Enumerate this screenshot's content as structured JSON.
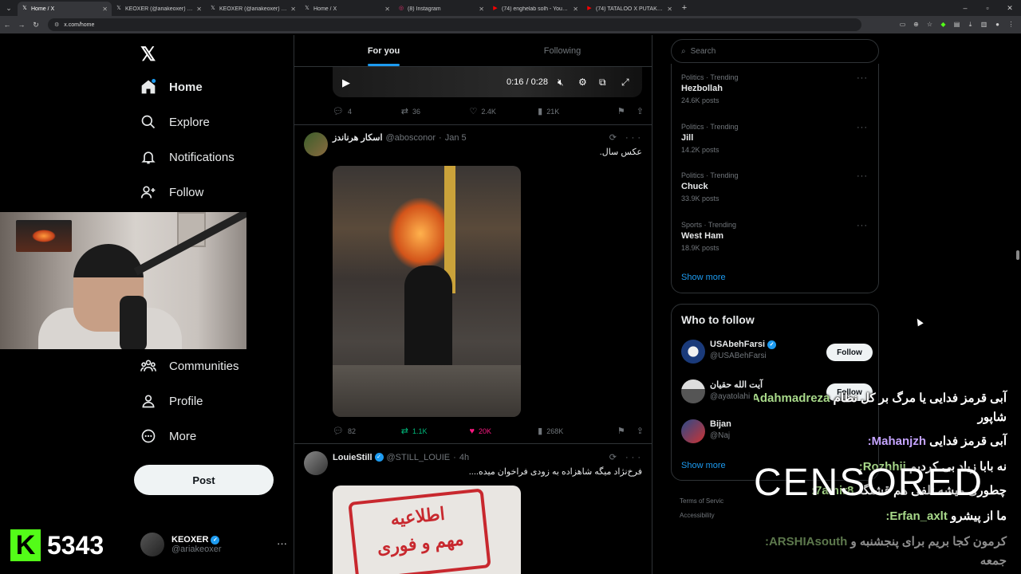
{
  "browser": {
    "tabs": [
      {
        "icon": "x-icon",
        "title": "Home / X",
        "active": true
      },
      {
        "icon": "x-icon",
        "title": "KEOXER (@ariakeoxer) / X"
      },
      {
        "icon": "x-icon",
        "title": "KEOXER (@ariakeoxer) / X"
      },
      {
        "icon": "x-icon",
        "title": "Home / X"
      },
      {
        "icon": "instagram-icon",
        "title": "(8) Instagram"
      },
      {
        "icon": "youtube-icon",
        "title": "(74) enghelab solh - YouTube"
      },
      {
        "icon": "youtube-icon",
        "title": "(74) TATALOO X PUTAK X PISHRO"
      }
    ],
    "url": "x.com/home"
  },
  "nav": {
    "items": [
      {
        "label": "Home",
        "icon": "home-icon"
      },
      {
        "label": "Explore",
        "icon": "search-icon"
      },
      {
        "label": "Notifications",
        "icon": "bell-icon"
      },
      {
        "label": "Follow",
        "icon": "follow-icon"
      },
      {
        "label": "Communities",
        "icon": "communities-icon"
      },
      {
        "label": "Profile",
        "icon": "profile-icon"
      },
      {
        "label": "More",
        "icon": "more-icon"
      }
    ],
    "post_label": "Post",
    "account": {
      "name": "KEOXER",
      "handle": "@ariakeoxer"
    }
  },
  "feed": {
    "tabs": [
      "For you",
      "Following"
    ],
    "video": {
      "time": "0:16 / 0:28"
    },
    "tweet0_stats": {
      "replies": "4",
      "reposts": "36",
      "likes": "2.4K",
      "views": "21K"
    },
    "tweet1": {
      "name": "اسکار هرناندز",
      "handle": "@abosconor",
      "date": "Jan 5",
      "text": "عکس سال.",
      "stats": {
        "replies": "82",
        "reposts": "1.1K",
        "likes": "20K",
        "views": "268K"
      }
    },
    "tweet2": {
      "name": "LouieStill",
      "handle": "@STILL_LOUIE",
      "date": "4h",
      "text": "فرخ‌نژاد میگه شاهزاده به زودی فراخوان میده....",
      "image_text_line1": "اطلاعیه",
      "image_text_line2": "مهم و فوری"
    }
  },
  "sidebar": {
    "search_placeholder": "Search",
    "trends": [
      {
        "category": "Politics · Trending",
        "name": "Hezbollah",
        "posts": "24.6K posts"
      },
      {
        "category": "Politics · Trending",
        "name": "Jill",
        "posts": "14.2K posts"
      },
      {
        "category": "Politics · Trending",
        "name": "Chuck",
        "posts": "33.9K posts"
      },
      {
        "category": "Sports · Trending",
        "name": "West Ham",
        "posts": "18.9K posts"
      }
    ],
    "show_more": "Show more",
    "who_to_follow": {
      "title": "Who to follow",
      "follow_label": "Follow",
      "accounts": [
        {
          "name": "USAbehFarsi",
          "handle": "@USABehFarsi"
        },
        {
          "name": "آیت الله حقیان",
          "handle": "@ayatolahi"
        },
        {
          "name": "Bijan",
          "handle": "@Naj"
        }
      ],
      "show_more": "Show more"
    },
    "footer": {
      "terms": "Terms of Servic",
      "accessibility": "Accessibility"
    }
  },
  "overlay": {
    "kick_count": "5343",
    "censored": "CENSORED",
    "chat": [
      {
        "user": "SAdahmadreza:",
        "msg": "آبی قرمز فدایی یا مرگ بر کل نظام"
      },
      {
        "user": "",
        "msg": "شاپور"
      },
      {
        "user": "Mahanjzh:",
        "msg": "آبی قرمز فدایی"
      },
      {
        "user": "Rozhhii:",
        "msg": "نه بابا زیاد بی کردیم"
      },
      {
        "user": "7amir8:",
        "msg": "چطوری میشه تلفی هم قشنگه"
      },
      {
        "user": "Erfan_axlt:",
        "msg": "ما از پیشرو"
      },
      {
        "user": "ARSHIAsouth:",
        "msg": "کرمون کجا بریم برای پنجشنبه و"
      },
      {
        "user": "",
        "msg": "جمعه"
      }
    ]
  }
}
